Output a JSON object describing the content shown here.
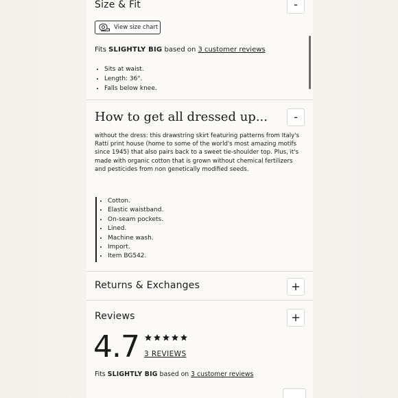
{
  "size_fit": {
    "title": "Size & Fit",
    "toggle": "-",
    "size_chart_label": "View size chart",
    "fits_prefix": "Fits",
    "fits_value": "SLIGHTLY BIG",
    "fits_mid": "based on",
    "fits_link": "3 customer reviews",
    "bullets": [
      "Sits at waist.",
      "Length: 36\".",
      "Falls below knee."
    ]
  },
  "dressed": {
    "title": "How to get all dressed up...",
    "toggle": "-",
    "description": "without the dress: this drawstring skirt featuring patterns from Italy's Ratti print house (home to some of the world's most amazing motifs since 1945) that also pairs back to a sweet tie-shoulder top. Plus, it's made with organic cotton that is grown without chemical fertilizers and pesticides from non genetically modified seeds.",
    "features": [
      "Cotton.",
      "Elastic waistband.",
      "On-seam pockets.",
      "Lined.",
      "Machine wash.",
      "Import.",
      "Item BG542."
    ]
  },
  "returns": {
    "title": "Returns & Exchanges",
    "toggle": "+"
  },
  "reviews": {
    "title": "Reviews",
    "toggle": "+",
    "rating": "4.7",
    "stars_filled": 4.7,
    "count_link": "3 REVIEWS",
    "fits_prefix": "Fits",
    "fits_value": "SLIGHTLY BIG",
    "fits_mid": "based on",
    "fits_link": "3 customer reviews"
  }
}
